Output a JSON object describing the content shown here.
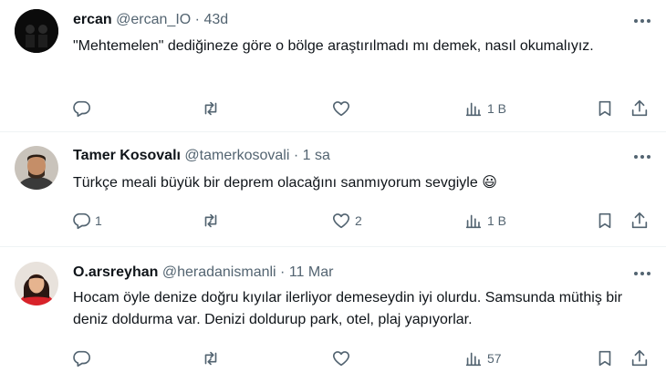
{
  "tweets": [
    {
      "name": "ercan",
      "handle": "@ercan_IO",
      "dot": "·",
      "time": "43d",
      "text": "\"Mehtemelen\" dediğineze göre o bölge araştırılmadı mı demek, nasıl okumalıyız.",
      "reply_count": "",
      "retweet_count": "",
      "like_count": "",
      "views": "1 B"
    },
    {
      "name": "Tamer Kosovalı",
      "handle": "@tamerkosovali",
      "dot": "·",
      "time": "1 sa",
      "text": "Türkçe meali büyük bir deprem olacağını sanmıyorum sevgiyle 😃",
      "reply_count": "1",
      "retweet_count": "",
      "like_count": "2",
      "views": "1 B"
    },
    {
      "name": "O.arsreyhan",
      "handle": "@heradanismanli",
      "dot": "·",
      "time": "11 Mar",
      "text": "Hocam öyle denize doğru kıyılar ilerliyor demeseydin iyi olurdu. Samsunda müthiş bir deniz doldurma var. Denizi doldurup park, otel, plaj yapıyorlar.",
      "reply_count": "",
      "retweet_count": "",
      "like_count": "",
      "views": "57"
    }
  ],
  "icons": {
    "reply": "reply-icon",
    "retweet": "retweet-icon",
    "like": "heart-icon",
    "views": "views-chart-icon",
    "bookmark": "bookmark-icon",
    "share": "share-icon",
    "more": "more-dots-icon"
  },
  "colors": {
    "text": "#0f1419",
    "muted": "#536471",
    "divider": "#eff3f4"
  }
}
